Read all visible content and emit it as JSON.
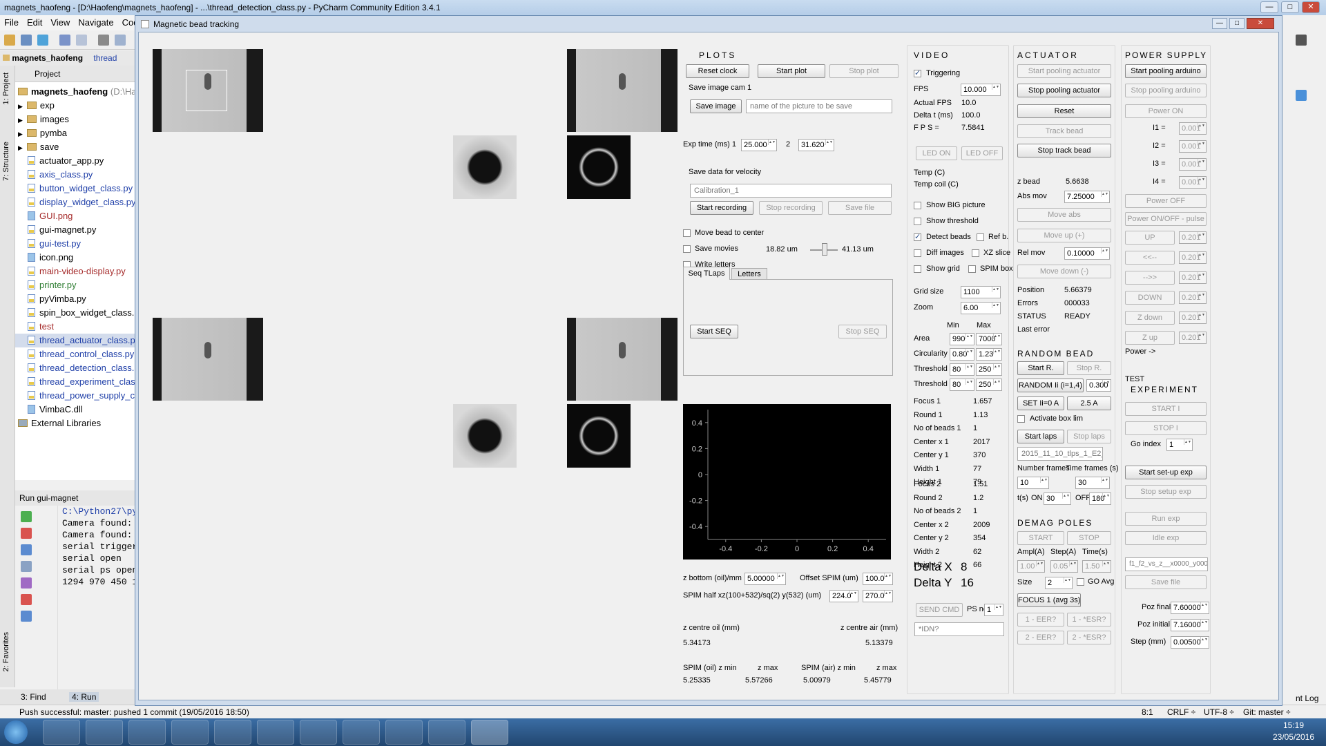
{
  "ide": {
    "title": "magnets_haofeng - [D:\\Haofeng\\magnets_haofeng] - ...\\thread_detection_class.py - PyCharm Community Edition 3.4.1",
    "menu": [
      "File",
      "Edit",
      "View",
      "Navigate",
      "Code"
    ],
    "project_tab": "magnets_haofeng",
    "file_tab": "thread",
    "project_head": "Project",
    "tree_root": "magnets_haofeng",
    "tree_root_path": "(D:\\Haof",
    "folders": [
      "exp",
      "images",
      "pymba",
      "save"
    ],
    "files": [
      {
        "name": "actuator_app.py",
        "color": "#000000",
        "type": "py"
      },
      {
        "name": "axis_class.py",
        "color": "#1f3fa8",
        "type": "py"
      },
      {
        "name": "button_widget_class.py",
        "color": "#1f3fa8",
        "type": "py"
      },
      {
        "name": "display_widget_class.py",
        "color": "#1f3fa8",
        "type": "py"
      },
      {
        "name": "GUI.png",
        "color": "#a52a2a",
        "type": "img"
      },
      {
        "name": "gui-magnet.py",
        "color": "#000000",
        "type": "py"
      },
      {
        "name": "gui-test.py",
        "color": "#1f3fa8",
        "type": "py"
      },
      {
        "name": "icon.png",
        "color": "#000000",
        "type": "img"
      },
      {
        "name": "main-video-display.py",
        "color": "#a52a2a",
        "type": "py"
      },
      {
        "name": "printer.py",
        "color": "#2e7d32",
        "type": "py"
      },
      {
        "name": "pyVimba.py",
        "color": "#000000",
        "type": "py"
      },
      {
        "name": "spin_box_widget_class.py",
        "color": "#000000",
        "type": "py"
      },
      {
        "name": "test",
        "color": "#a52a2a",
        "type": "py"
      },
      {
        "name": "thread_actuator_class.py",
        "color": "#1f3fa8",
        "type": "py"
      },
      {
        "name": "thread_control_class.py",
        "color": "#1f3fa8",
        "type": "py"
      },
      {
        "name": "thread_detection_class.py",
        "color": "#1f3fa8",
        "type": "py"
      },
      {
        "name": "thread_experiment_class.py",
        "color": "#1f3fa8",
        "type": "py"
      },
      {
        "name": "thread_power_supply_class.py",
        "color": "#1f3fa8",
        "type": "py"
      },
      {
        "name": "VimbaC.dll",
        "color": "#000000",
        "type": "img"
      }
    ],
    "external_libraries": "External Libraries",
    "run_head": "Run",
    "run_config": "gui-magnet",
    "console": [
      "C:\\Python27\\py",
      "Camera found:",
      "Camera found:",
      "serial trigger",
      "serial open",
      "serial ps open",
      "1294 970 450 1"
    ],
    "bottom_tabs": [
      "3: Find",
      "4: Run"
    ],
    "side_labels": [
      "1: Project",
      "7: Structure",
      "2: Favorites"
    ],
    "status_msg": "Push successful: master: pushed 1 commit (19/05/2016 18:50)",
    "status_pos": "8:1",
    "status_crlf": "CRLF ÷",
    "status_enc": "UTF-8 ÷",
    "status_git": "Git: master ÷",
    "event_log": "nt Log",
    "clock_time": "15:19",
    "clock_date": "23/05/2016"
  },
  "window": {
    "title": "Magnetic bead tracking"
  },
  "plots": {
    "title": "PLOTS",
    "reset_clock": "Reset clock",
    "start_plot": "Start plot",
    "stop_plot": "Stop plot",
    "save_image_cam": "Save image cam 1",
    "save_image": "Save image",
    "image_name_placeholder": "name of the picture to be save",
    "exp_time_label": "Exp time (ms) 1",
    "exp_time_1": "25.000",
    "exp_2_label": "2",
    "exp_time_2": "31.620",
    "save_data_label": "Save data for velocity",
    "calib_placeholder": "Calibration_1",
    "start_recording": "Start recording",
    "stop_recording": "Stop recording",
    "save_file": "Save file",
    "move_bead": "Move bead to center",
    "save_movies": "Save movies",
    "write_letters": "Write letters",
    "slider_min": "18.82 um",
    "slider_max": "41.13 um",
    "tab_seq": "Seq TLaps",
    "tab_letters": "Letters",
    "start_seq": "Start SEQ",
    "stop_seq": "Stop SEQ",
    "z_bottom_label": "z bottom (oil)/mm",
    "z_bottom": "5.00000",
    "offset_label": "Offset SPIM (um)",
    "offset": "100.0",
    "spim_half_label": "SPIM half xz(100+532)/sq(2) y(532) (um)",
    "spim_half_xz": "224.0",
    "spim_half_y": "270.0",
    "z_centre_oil_label": "z centre oil (mm)",
    "z_centre_oil": "5.34173",
    "z_centre_air_label": "z centre air (mm)",
    "z_centre_air": "5.13379",
    "spim_oil_zmin_label": "SPIM (oil) z min",
    "spim_oil_zmin": "5.25335",
    "zmax_label1": "z max",
    "zmax1": "5.57266",
    "spim_air_zmin_label": "SPIM (air) z min",
    "spim_air_zmin": "5.00979",
    "zmax_label2": "z max",
    "zmax2": "5.45779"
  },
  "chart_data": {
    "type": "scatter",
    "x": [],
    "y": [],
    "xlim": [
      -0.5,
      0.5
    ],
    "ylim": [
      -0.5,
      0.5
    ],
    "xticks": [
      "-0.4",
      "-0.2",
      "0",
      "0.2",
      "0.4"
    ],
    "yticks": [
      "0.4",
      "0.2",
      "0",
      "-0.2",
      "-0.4"
    ],
    "background": "#000000"
  },
  "video": {
    "title": "VIDEO",
    "triggering": "Triggering",
    "fps_label": "FPS",
    "fps": "10.000",
    "actual_fps_label": "Actual FPS",
    "actual_fps": "10.0",
    "delta_t_label": "Delta t (ms)",
    "delta_t": "100.0",
    "fps2_label": "F P S =",
    "fps2": "7.5841",
    "led_on": "LED ON",
    "led_off": "LED OFF",
    "temp": "Temp (C)",
    "temp_coil": "Temp coil (C)",
    "show_big": "Show BIG picture",
    "show_threshold": "Show threshold",
    "detect_beads": "Detect beads",
    "ref_b": "Ref b.",
    "diff_images": "Diff images",
    "xz_slice": "XZ slice",
    "show_grid": "Show grid",
    "spim_box": "SPIM box",
    "grid_size_label": "Grid size",
    "grid_size": "1100",
    "zoom_label": "Zoom",
    "zoom": "6.00",
    "min": "Min",
    "max": "Max",
    "area_label": "Area",
    "area_min": "990",
    "area_max": "7000",
    "circ_label": "Circularity",
    "circ_min": "0.80",
    "circ_max": "1.23",
    "th1_label": "Threshold 1",
    "th1_min": "80",
    "th1_max": "250",
    "th2_label": "Threshold 2",
    "th2_min": "80",
    "th2_max": "250",
    "stats1": [
      [
        "Focus 1",
        "1.657"
      ],
      [
        "Round 1",
        "1.13"
      ],
      [
        "No of beads 1",
        "1"
      ],
      [
        "Center x 1",
        "2017"
      ],
      [
        "Center y 1",
        "370"
      ],
      [
        "Width 1",
        "77"
      ],
      [
        "Height 1",
        "79"
      ]
    ],
    "stats2": [
      [
        "Focus 2",
        "1.51"
      ],
      [
        "Round 2",
        "1.2"
      ],
      [
        "No of beads 2",
        "1"
      ],
      [
        "Center x 2",
        "2009"
      ],
      [
        "Center y 2",
        "354"
      ],
      [
        "Width 2",
        "62"
      ],
      [
        "Height 2",
        "66"
      ]
    ],
    "delta_x_label": "Delta X",
    "delta_x": "8",
    "delta_y_label": "Delta Y",
    "delta_y": "16",
    "send_cmd": "SEND CMD",
    "ps_no_label": "PS no",
    "ps_no": "1",
    "idn_placeholder": "*IDN?"
  },
  "actuator": {
    "title": "ACTUATOR",
    "start_pooling": "Start pooling actuator",
    "stop_pooling": "Stop pooling actuator",
    "reset": "Reset",
    "track_bead": "Track bead",
    "stop_track": "Stop track bead",
    "z_bead_label": "z bead",
    "z_bead": "5.6638",
    "abs_mov_label": "Abs mov",
    "abs_mov": "7.25000",
    "move_abs": "Move abs",
    "move_up": "Move up (+)",
    "rel_mov_label": "Rel mov",
    "rel_mov": "0.10000",
    "move_down": "Move down (-)",
    "position_label": "Position",
    "position": "5.66379",
    "errors_label": "Errors",
    "errors": "000033",
    "status_label": "STATUS",
    "status": "READY",
    "last_error_label": "Last error",
    "random_title": "RANDOM BEAD",
    "start_r": "Start R.",
    "stop_r": "Stop R.",
    "random_ii": "RANDOM Ii (i=1,4)",
    "random_val": "0.300",
    "set_ii": "SET Ii=0 A",
    "set_25": "2.5 A",
    "activate_box": "Activate box lim",
    "start_laps": "Start laps",
    "stop_laps": "Stop laps",
    "laps_name": "2015_11_10_tlps_1_E2_",
    "nframes_label": "Number frames",
    "tframes_label": "Time frames (s)",
    "nframes": "10",
    "tframes": "30",
    "ts_label": "t(s)",
    "on_label": "ON",
    "on_val": "30",
    "off_label": "OFF",
    "off_val": "180",
    "demag_title": "DEMAG POLES",
    "demag_start": "START",
    "demag_stop": "STOP",
    "ampl_label": "Ampl(A)",
    "step_label": "Step(A)",
    "time_label": "Time(s)",
    "ampl": "1.00",
    "step": "0.05",
    "time": "1.50",
    "size_label": "Size",
    "size": "2",
    "go_avg": "GO Avg",
    "focus1": "FOCUS 1 (avg 3s)",
    "eer1": "1 - EER?",
    "esr1": "1 - *ESR?",
    "eer2": "2 - EER?",
    "esr2": "2 - *ESR?"
  },
  "power": {
    "title": "POWER SUPPLY",
    "start_arduino": "Start pooling arduino",
    "stop_arduino": "Stop pooling arduino",
    "power_on": "Power ON",
    "currents": [
      [
        "I1 =",
        "0.001"
      ],
      [
        "I2 =",
        "0.001"
      ],
      [
        "I3 =",
        "0.001"
      ],
      [
        "I4 =",
        "0.001"
      ]
    ],
    "power_off": "Power OFF",
    "power_pulse": "Power ON/OFF - pulse",
    "moves": [
      [
        "UP",
        "0.201"
      ],
      [
        "<<--",
        "0.201"
      ],
      [
        "-->>",
        "0.201"
      ],
      [
        "DOWN",
        "0.201"
      ],
      [
        "Z down",
        "0.201"
      ],
      [
        "Z up",
        "0.201"
      ]
    ],
    "power_arrow": "Power ->",
    "test": "TEST",
    "exp_title": "EXPERIMENT",
    "start_i": "START I",
    "stop_i": "STOP I",
    "go_index_label": "Go index",
    "go_index": "1",
    "start_setup": "Start set-up exp",
    "stop_setup": "Stop setup exp",
    "run_exp": "Run exp",
    "idle_exp": "Idle exp",
    "file_name": "f1_f2_vs_z__x0000_y000",
    "save_file": "Save file",
    "poz_final_label": "Poz final",
    "poz_final": "7.60000",
    "poz_initial_label": "Poz initial",
    "poz_initial": "7.16000",
    "step_label": "Step (mm)",
    "step": "0.00500"
  }
}
